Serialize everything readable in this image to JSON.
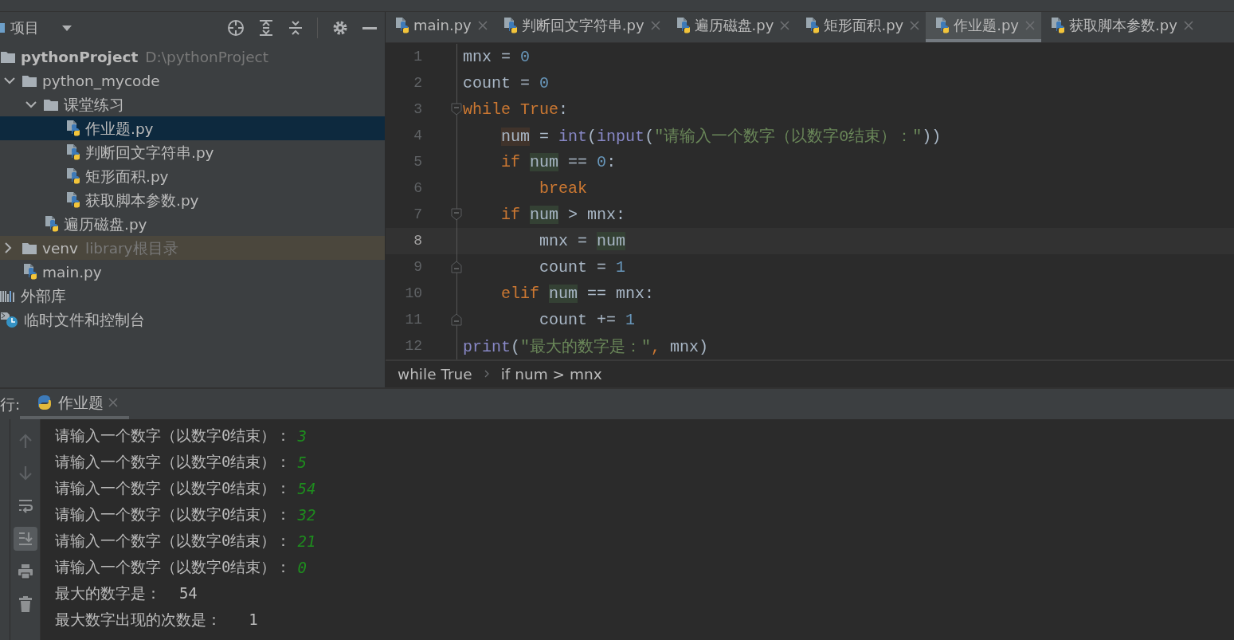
{
  "project_panel": {
    "title": "项目",
    "tree": [
      {
        "label": "pythonProject",
        "hint": "D:\\pythonProject",
        "kind": "project",
        "selected": false,
        "children": [
          {
            "label": "python_mycode",
            "kind": "folder",
            "expanded": true,
            "selected": false,
            "children": [
              {
                "label": "课堂练习",
                "kind": "folder",
                "expanded": true,
                "selected": false,
                "children": [
                  {
                    "label": "作业题.py",
                    "kind": "file",
                    "selected": true
                  },
                  {
                    "label": "判断回文字符串.py",
                    "kind": "file",
                    "selected": false
                  },
                  {
                    "label": "矩形面积.py",
                    "kind": "file",
                    "selected": false
                  },
                  {
                    "label": "获取脚本参数.py",
                    "kind": "file",
                    "selected": false
                  }
                ]
              },
              {
                "label": "遍历磁盘.py",
                "kind": "file",
                "selected": false
              }
            ]
          },
          {
            "label": "venv",
            "hint": "library根目录",
            "kind": "library",
            "expanded": false,
            "selected": false
          },
          {
            "label": "main.py",
            "kind": "file",
            "selected": false
          }
        ]
      },
      {
        "label": "外部库",
        "kind": "external",
        "selected": false
      },
      {
        "label": "临时文件和控制台",
        "kind": "scratches",
        "selected": false
      }
    ]
  },
  "editor": {
    "tabs": [
      {
        "label": "main.py",
        "selected": false
      },
      {
        "label": "判断回文字符串.py",
        "selected": false
      },
      {
        "label": "遍历磁盘.py",
        "selected": false
      },
      {
        "label": "矩形面积.py",
        "selected": false
      },
      {
        "label": "作业题.py",
        "selected": true
      },
      {
        "label": "获取脚本参数.py",
        "selected": false
      }
    ],
    "lines": [
      {
        "number": "1",
        "current": false,
        "tokens": [
          {
            "text": "mnx = ",
            "kind": "plain"
          },
          {
            "text": "0",
            "kind": "number"
          }
        ]
      },
      {
        "number": "2",
        "current": false,
        "tokens": [
          {
            "text": "count = ",
            "kind": "plain"
          },
          {
            "text": "0",
            "kind": "number"
          }
        ]
      },
      {
        "number": "3",
        "current": false,
        "block_start": true,
        "tokens": [
          {
            "text": "while True",
            "kind": "keyword"
          },
          {
            "text": ":",
            "kind": "plain"
          }
        ]
      },
      {
        "number": "4",
        "current": false,
        "tokens": [
          {
            "text": "    num",
            "kind": "write"
          },
          {
            "text": " = ",
            "kind": "plain"
          },
          {
            "text": "int",
            "kind": "builtin"
          },
          {
            "text": "(",
            "kind": "plain"
          },
          {
            "text": "input",
            "kind": "builtin"
          },
          {
            "text": "(",
            "kind": "plain"
          },
          {
            "text": "\"请输入一个数字（以数字0结束）：\"",
            "kind": "string"
          },
          {
            "text": "))",
            "kind": "plain"
          }
        ]
      },
      {
        "number": "5",
        "current": false,
        "tokens": [
          {
            "text": "    if ",
            "kind": "keyword"
          },
          {
            "text": "num",
            "kind": "read"
          },
          {
            "text": " == ",
            "kind": "plain"
          },
          {
            "text": "0",
            "kind": "number"
          },
          {
            "text": ":",
            "kind": "plain"
          }
        ]
      },
      {
        "number": "6",
        "current": false,
        "tokens": [
          {
            "text": "        break",
            "kind": "keyword"
          }
        ]
      },
      {
        "number": "7",
        "current": false,
        "block_start": true,
        "tokens": [
          {
            "text": "    if ",
            "kind": "keyword"
          },
          {
            "text": "num",
            "kind": "read"
          },
          {
            "text": " > mnx:",
            "kind": "plain"
          }
        ]
      },
      {
        "number": "8",
        "current": true,
        "tokens": [
          {
            "text": "        mnx = ",
            "kind": "plain"
          },
          {
            "text": "num",
            "kind": "read"
          }
        ]
      },
      {
        "number": "9",
        "current": false,
        "block_end": true,
        "tokens": [
          {
            "text": "        count = ",
            "kind": "plain"
          },
          {
            "text": "1",
            "kind": "number"
          }
        ]
      },
      {
        "number": "10",
        "current": false,
        "tokens": [
          {
            "text": "    elif ",
            "kind": "keyword"
          },
          {
            "text": "num",
            "kind": "read"
          },
          {
            "text": " == mnx:",
            "kind": "plain"
          }
        ]
      },
      {
        "number": "11",
        "current": false,
        "block_end": true,
        "tokens": [
          {
            "text": "        count += ",
            "kind": "plain"
          },
          {
            "text": "1",
            "kind": "number"
          }
        ]
      },
      {
        "number": "12",
        "current": false,
        "tokens": [
          {
            "text": "print",
            "kind": "builtin"
          },
          {
            "text": "(",
            "kind": "plain"
          },
          {
            "text": "\"最大的数字是：\"",
            "kind": "string"
          },
          {
            "text": ",",
            "kind": "keyword"
          },
          {
            "text": " mnx)",
            "kind": "plain"
          }
        ]
      }
    ],
    "breadcrumbs": [
      "while True",
      "if num > mnx"
    ]
  },
  "run_panel": {
    "label": "行:",
    "tab": {
      "label": "作业题",
      "selected": true
    },
    "output": [
      {
        "text": "请输入一个数字（以数字0结束）：",
        "input": "3"
      },
      {
        "text": "请输入一个数字（以数字0结束）：",
        "input": "5"
      },
      {
        "text": "请输入一个数字（以数字0结束）：",
        "input": "54"
      },
      {
        "text": "请输入一个数字（以数字0结束）：",
        "input": "32"
      },
      {
        "text": "请输入一个数字（以数字0结束）：",
        "input": "21"
      },
      {
        "text": "请输入一个数字（以数字0结束）：",
        "input": "0"
      },
      {
        "text": "最大的数字是：  54"
      },
      {
        "text": "最大数字出现的次数是：   1"
      }
    ]
  }
}
